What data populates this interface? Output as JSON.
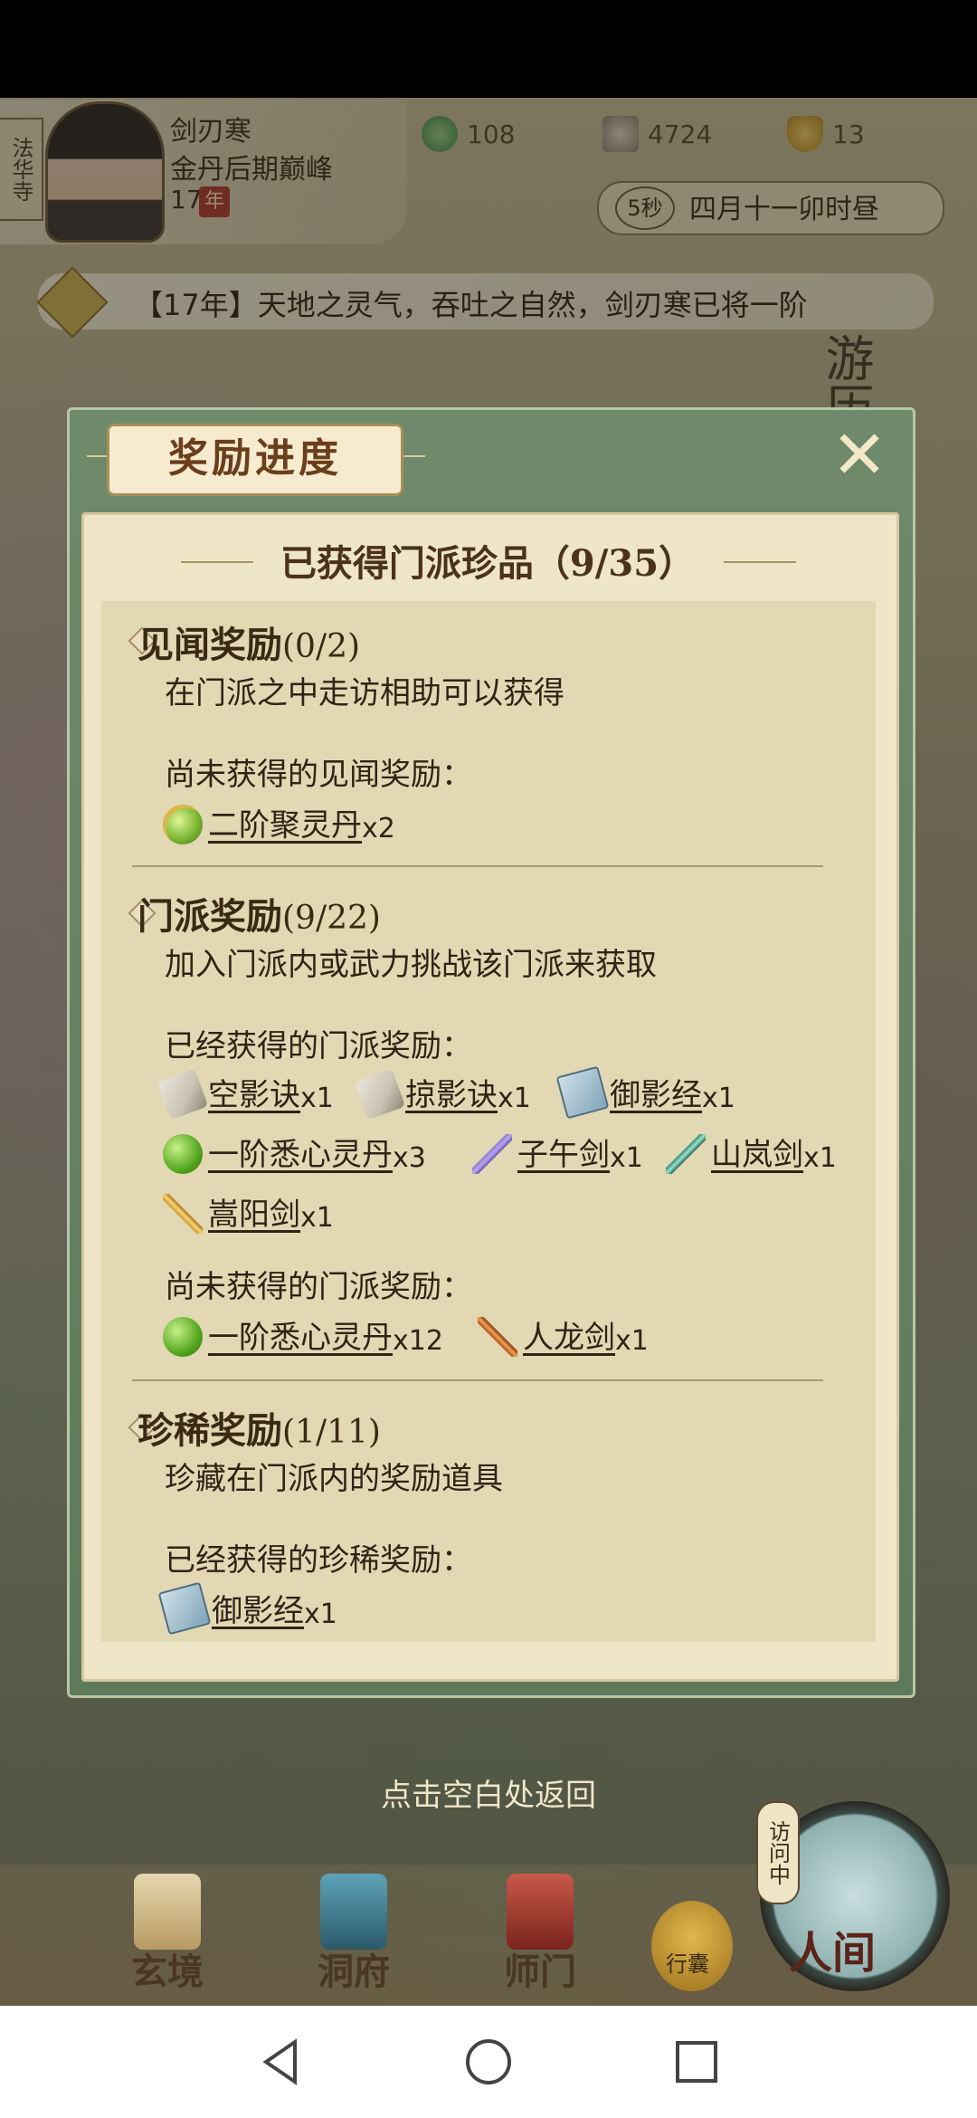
{
  "player": {
    "sect_tag": "法华寺",
    "name": "剑刃寒",
    "realm": "金丹后期巅峰",
    "age": "17",
    "age_unit": "年"
  },
  "resources": [
    {
      "icon": "spirit-stone-icon",
      "value": "108"
    },
    {
      "icon": "coin-icon",
      "value": "4724"
    },
    {
      "icon": "gold-ingot-icon",
      "value": "13"
    }
  ],
  "clock": {
    "seconds": "5秒",
    "time": "四月十一卯时昼"
  },
  "notice": {
    "text": "【17年】天地之灵气，吞吐之自然，剑刃寒已将一阶"
  },
  "side_text": "游历",
  "modal": {
    "title": "奖励进度",
    "heading": "已获得门派珍品（9/35）",
    "sections": {
      "jianwen": {
        "title": "见闻奖励",
        "count": "(0/2)",
        "desc": "在门派之中走访相助可以获得",
        "missing_label": "尚未获得的见闻奖励：",
        "missing": [
          {
            "name": "二阶聚灵丹",
            "qty": "x2",
            "icon": "green-elixir-icon"
          }
        ]
      },
      "menpai": {
        "title": "门派奖励",
        "count": "(9/22)",
        "desc": "加入门派内或武力挑战该门派来获取",
        "obtained_label": "已经获得的门派奖励：",
        "obtained": [
          {
            "name": "空影诀",
            "qty": "x1",
            "icon": "scroll-icon"
          },
          {
            "name": "掠影诀",
            "qty": "x1",
            "icon": "scroll-icon"
          },
          {
            "name": "御影经",
            "qty": "x1",
            "icon": "book-icon"
          },
          {
            "name": "一阶悉心灵丹",
            "qty": "x3",
            "icon": "green-pill-icon"
          },
          {
            "name": "子午剑",
            "qty": "x1",
            "icon": "purple-sword-icon"
          },
          {
            "name": "山岚剑",
            "qty": "x1",
            "icon": "green-sword-icon"
          },
          {
            "name": "嵩阳剑",
            "qty": "x1",
            "icon": "gold-sword-icon"
          }
        ],
        "missing_label": "尚未获得的门派奖励：",
        "missing": [
          {
            "name": "一阶悉心灵丹",
            "qty": "x12",
            "icon": "green-pill-icon"
          },
          {
            "name": "人龙剑",
            "qty": "x1",
            "icon": "red-sword-icon"
          }
        ]
      },
      "zhenxi": {
        "title": "珍稀奖励",
        "count": "(1/11)",
        "desc": "珍藏在门派内的奖励道具",
        "obtained_label": "已经获得的珍稀奖励：",
        "obtained": [
          {
            "name": "御影经",
            "qty": "x1",
            "icon": "book-icon"
          }
        ]
      }
    },
    "return_hint": "点击空白处返回"
  },
  "nav": {
    "items": [
      "玄境",
      "洞府",
      "师门"
    ],
    "bag": "行囊",
    "visiting": "访问中",
    "world": "人间"
  }
}
